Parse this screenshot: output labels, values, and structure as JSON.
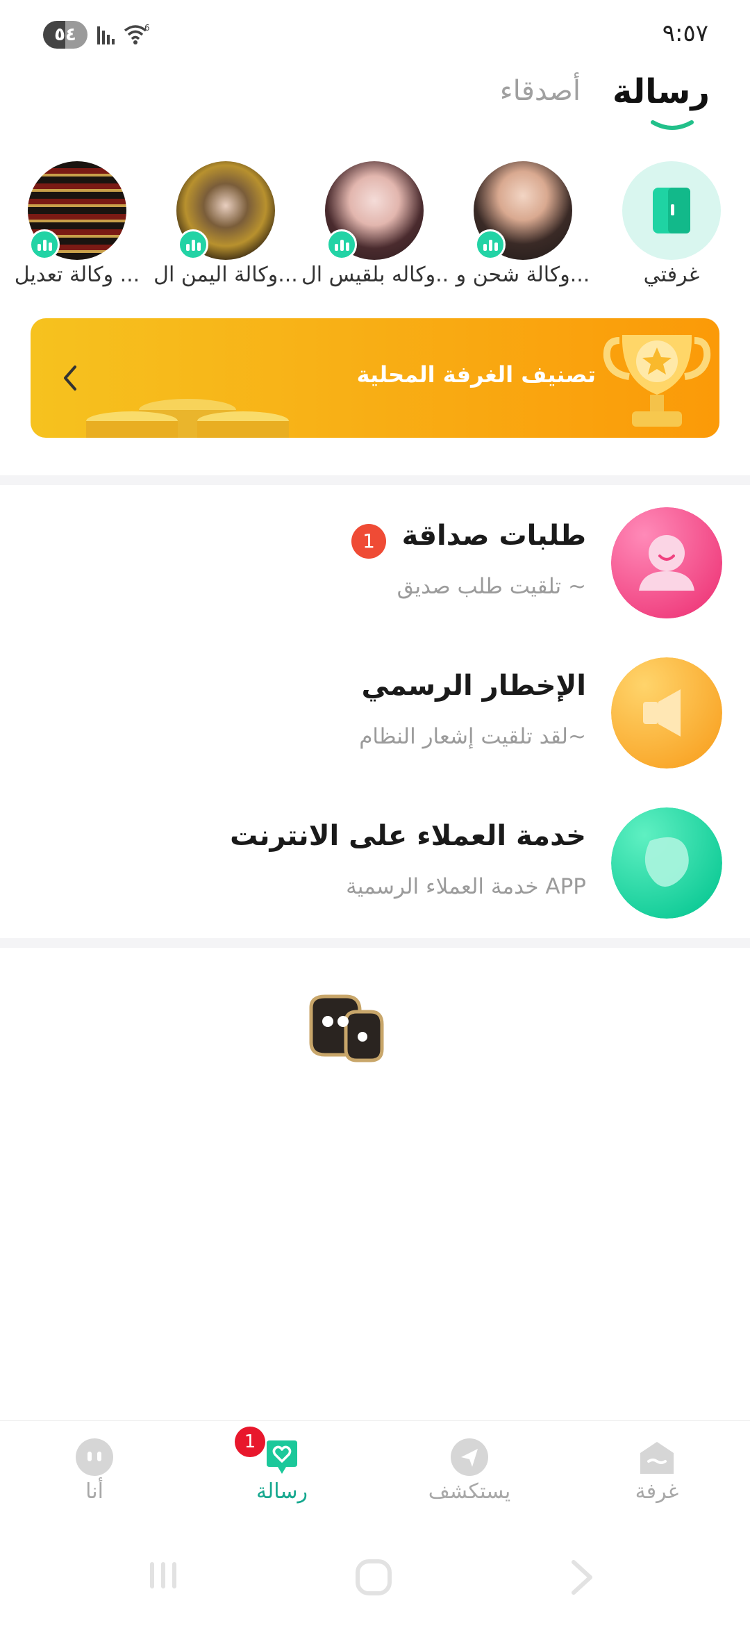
{
  "status_bar": {
    "battery": "٥٤",
    "network_type": "6",
    "time": "٩:٥٧"
  },
  "header": {
    "tabs": [
      {
        "label": "رسالة",
        "active": true
      },
      {
        "label": "أصدقاء",
        "active": false
      }
    ],
    "accent_color": "#22c08a"
  },
  "stories": [
    {
      "name": "غرفتي",
      "icon": "door-icon"
    },
    {
      "name": "وكالة شحن و...",
      "live": true
    },
    {
      "name": "وكاله بلقيس ال..",
      "live": true
    },
    {
      "name": "وكالة اليمن ال...",
      "live": true
    },
    {
      "name": "وكالة تعديل ...",
      "live": true
    }
  ],
  "banner": {
    "title": "تصنيف الغرفة المحلية",
    "icon": "trophy-icon"
  },
  "messages": [
    {
      "title": "طلبات صداقة",
      "subtitle": "تلقيت طلب صديق ~",
      "badge": "1",
      "icon": "friend-request-icon",
      "color": "#f24d90"
    },
    {
      "title": "الإخطار الرسمي",
      "subtitle": "لقد تلقيت إشعار النظام~",
      "icon": "megaphone-icon",
      "color": "#fbb13a"
    },
    {
      "title": "خدمة العملاء على الانترنت",
      "subtitle": "خدمة العملاء الرسمية APP",
      "icon": "chat-bubble-icon",
      "color": "#21d9a4"
    }
  ],
  "bottom_nav": [
    {
      "label": "غرفة",
      "icon": "home-icon",
      "active": false
    },
    {
      "label": "يستكشف",
      "icon": "send-icon",
      "active": false
    },
    {
      "label": "رسالة",
      "icon": "message-heart-icon",
      "active": true,
      "badge": "1"
    },
    {
      "label": "أنا",
      "icon": "profile-icon",
      "active": false
    }
  ]
}
